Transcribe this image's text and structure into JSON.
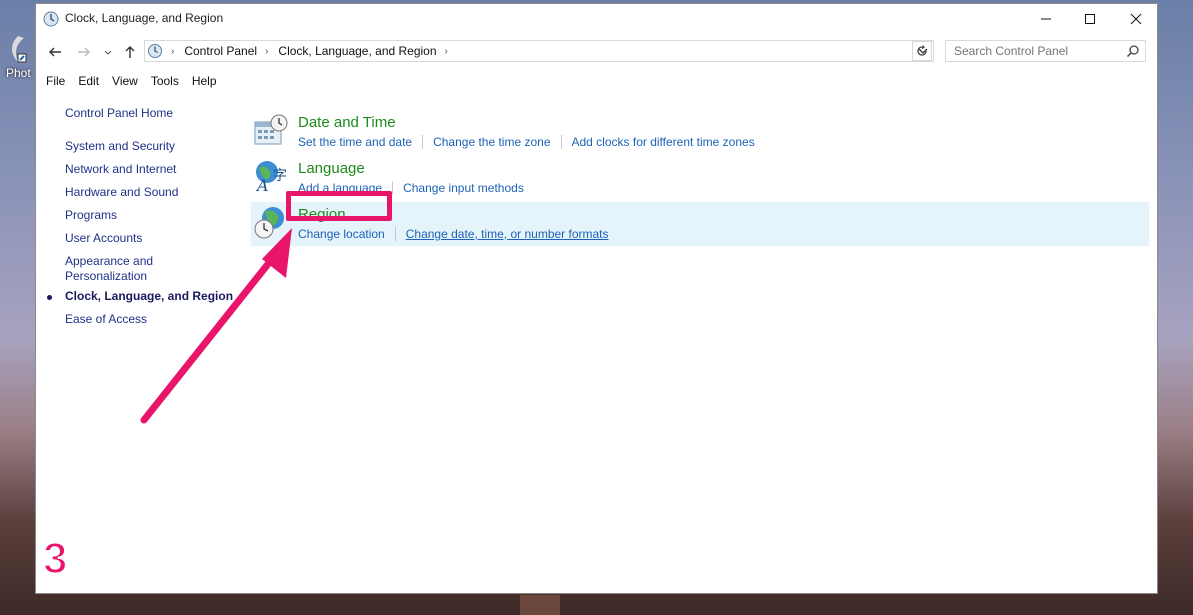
{
  "desktop": {
    "icon_label": "Phot"
  },
  "window": {
    "title": "Clock, Language, and Region"
  },
  "address": {
    "crumbs": [
      "Control Panel",
      "Clock, Language, and Region"
    ],
    "search_placeholder": "Search Control Panel"
  },
  "menu": [
    "File",
    "Edit",
    "View",
    "Tools",
    "Help"
  ],
  "sidebar": {
    "home": "Control Panel Home",
    "items": [
      "System and Security",
      "Network and Internet",
      "Hardware and Sound",
      "Programs",
      "User Accounts",
      "Appearance and",
      "Personalization",
      "Clock, Language, and Region",
      "Ease of Access"
    ]
  },
  "categories": [
    {
      "title": "Date and Time",
      "links": [
        "Set the time and date",
        "Change the time zone",
        "Add clocks for different time zones"
      ]
    },
    {
      "title": "Language",
      "links": [
        "Add a language",
        "Change input methods"
      ]
    },
    {
      "title": "Region",
      "links": [
        "Change location",
        "Change date, time, or number formats"
      ]
    }
  ],
  "annotation": {
    "step": "3",
    "color": "#e8156b"
  }
}
